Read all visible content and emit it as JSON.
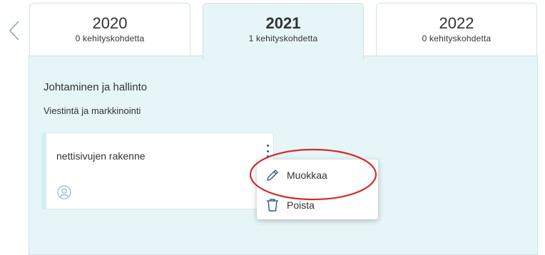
{
  "tabs": [
    {
      "year": "2020",
      "count": "0 kehityskohdetta"
    },
    {
      "year": "2021",
      "count": "1 kehityskohdetta"
    },
    {
      "year": "2022",
      "count": "0 kehityskohdetta"
    }
  ],
  "active_tab": "2021",
  "section": {
    "heading": "Johtaminen ja hallinto",
    "subheading": "Viestintä ja markkinointi"
  },
  "card": {
    "title": "nettisivujen rakenne"
  },
  "context_menu": {
    "items": [
      {
        "label": "Muokkaa",
        "icon": "pencil-icon"
      },
      {
        "label": "Poista",
        "icon": "trash-icon"
      }
    ]
  },
  "colors": {
    "panel_bg": "#e6f5f7",
    "highlight_ring": "#d42a2a",
    "kebab": "#2b5d80",
    "icon": "#2b5d80"
  }
}
